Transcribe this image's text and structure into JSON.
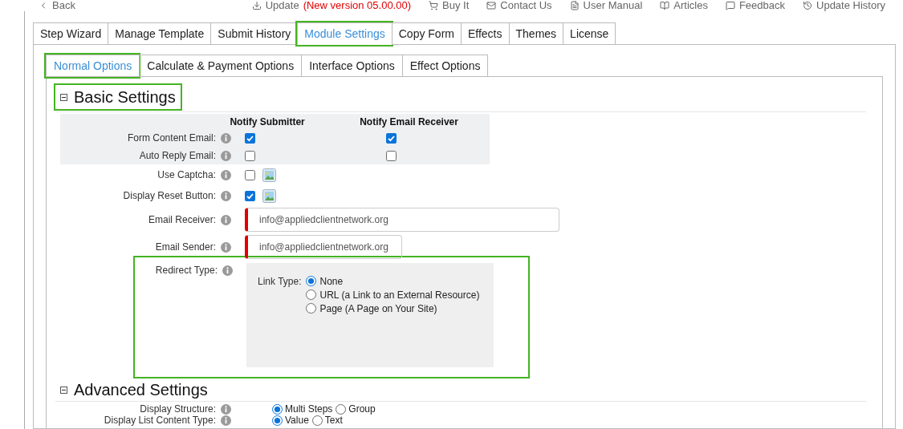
{
  "top_links": [
    {
      "kind": "back",
      "label": "Back"
    },
    {
      "kind": "update",
      "label": "Update",
      "note": "(New version 05.00.00)"
    },
    {
      "kind": "buy",
      "label": "Buy It"
    },
    {
      "kind": "contact",
      "label": "Contact Us"
    },
    {
      "kind": "manual",
      "label": "User Manual"
    },
    {
      "kind": "articles",
      "label": "Articles"
    },
    {
      "kind": "feedback",
      "label": "Feedback"
    },
    {
      "kind": "history",
      "label": "Update History"
    }
  ],
  "tabs": [
    {
      "label": "Step Wizard",
      "selected": false,
      "highlighted": false
    },
    {
      "label": "Manage Template",
      "selected": false,
      "highlighted": false
    },
    {
      "label": "Submit History",
      "selected": false,
      "highlighted": false
    },
    {
      "label": "Module Settings",
      "selected": true,
      "highlighted": true
    },
    {
      "label": "Copy Form",
      "selected": false,
      "highlighted": false
    },
    {
      "label": "Effects",
      "selected": false,
      "highlighted": false
    },
    {
      "label": "Themes",
      "selected": false,
      "highlighted": false
    },
    {
      "label": "License",
      "selected": false,
      "highlighted": false
    }
  ],
  "sub_tabs": [
    {
      "label": "Normal Options",
      "selected": true,
      "highlighted": true
    },
    {
      "label": "Calculate & Payment Options",
      "selected": false,
      "highlighted": false
    },
    {
      "label": "Interface Options",
      "selected": false,
      "highlighted": false
    },
    {
      "label": "Effect Options",
      "selected": false,
      "highlighted": false
    }
  ],
  "basic_settings": {
    "title": "Basic Settings",
    "expanded": true,
    "highlighted": true,
    "notify_table": {
      "columns": [
        "Notify Submitter",
        "Notify Email Receiver"
      ],
      "rows": [
        {
          "label": "Form Content Email:",
          "checks": [
            true,
            true
          ]
        },
        {
          "label": "Auto Reply Email:",
          "checks": [
            false,
            false
          ]
        }
      ]
    },
    "fields": [
      {
        "kind": "checkbox",
        "label": "Use Captcha:",
        "checked": false
      },
      {
        "kind": "checkbox",
        "label": "Display Reset Button:",
        "checked": true
      },
      {
        "kind": "text",
        "label": "Email Receiver:",
        "value": "info@appliedclientnetwork.org",
        "required": true,
        "wide": true
      },
      {
        "kind": "text",
        "label": "Email Sender:",
        "value": "info@appliedclientnetwork.org",
        "required": true,
        "wide": false
      },
      {
        "kind": "redirect",
        "label": "Redirect Type:",
        "highlighted": true,
        "link_label": "Link Type:",
        "options": [
          {
            "label": "None",
            "selected": true
          },
          {
            "label": "URL (a Link to an External Resource)",
            "selected": false
          },
          {
            "label": "Page (A Page on Your Site)",
            "selected": false
          }
        ]
      }
    ]
  },
  "advanced_settings": {
    "title": "Advanced Settings",
    "expanded": true,
    "fields": [
      {
        "label": "Display Structure:",
        "options": [
          {
            "label": "Multi Steps",
            "selected": true
          },
          {
            "label": "Group",
            "selected": false
          }
        ]
      },
      {
        "label": "Display List Content Type:",
        "options": [
          {
            "label": "Value",
            "selected": true
          },
          {
            "label": "Text",
            "selected": false
          }
        ]
      }
    ]
  }
}
